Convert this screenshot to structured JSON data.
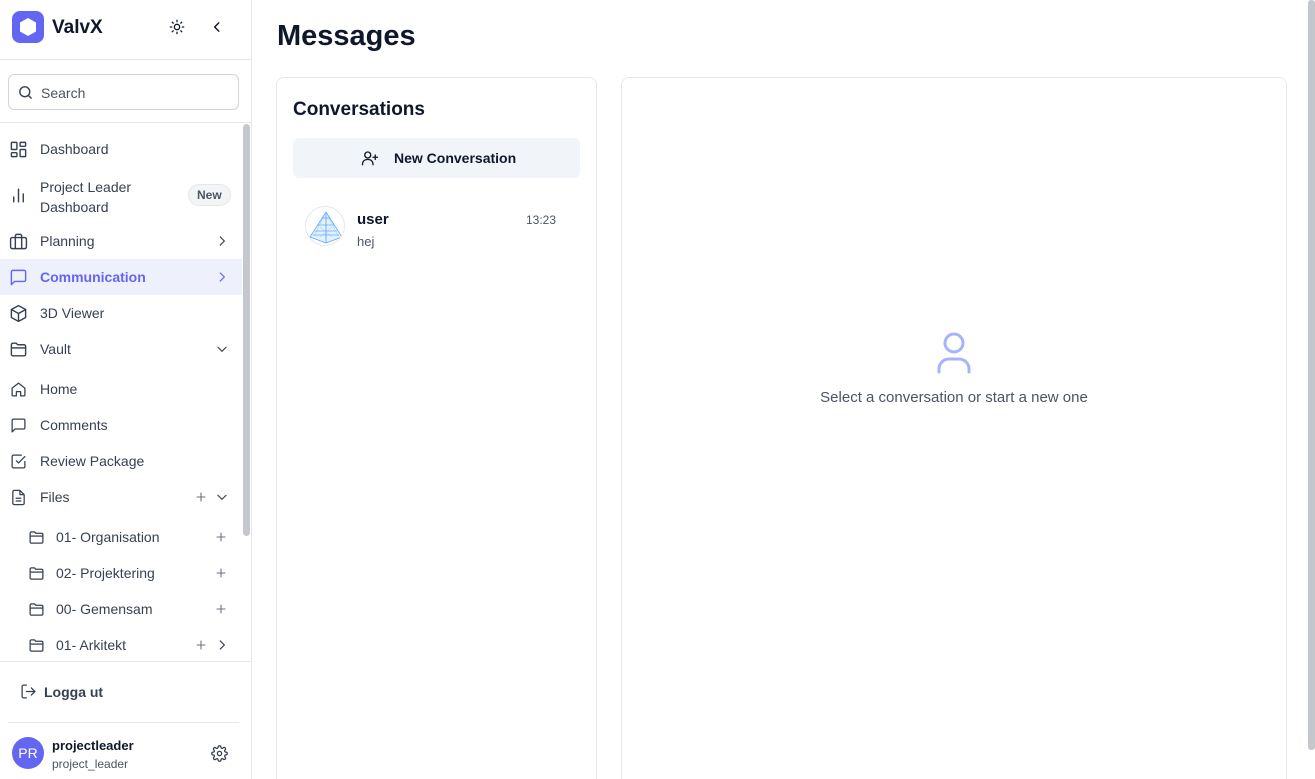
{
  "app": {
    "name": "ValvX"
  },
  "search": {
    "placeholder": "Search"
  },
  "nav": {
    "dashboard": "Dashboard",
    "pl_dashboard_line1": "Project Leader",
    "pl_dashboard_line2": "Dashboard",
    "pl_badge": "New",
    "planning": "Planning",
    "communication": "Communication",
    "viewer3d": "3D Viewer",
    "vault": "Vault",
    "home": "Home",
    "comments": "Comments",
    "review": "Review Package",
    "files": "Files",
    "folders": [
      "01- Organisation",
      "02- Projektering",
      "00- Gemensam",
      "01- Arkitekt"
    ]
  },
  "footer": {
    "logout": "Logga ut",
    "avatar_initials": "PR",
    "username": "projectleader",
    "role": "project_leader"
  },
  "main": {
    "title": "Messages",
    "conversations_title": "Conversations",
    "new_conversation": "New Conversation",
    "conversations": [
      {
        "name": "user",
        "time": "13:23",
        "last_message": "hej"
      }
    ],
    "empty_state": "Select a conversation or start a new one"
  },
  "colors": {
    "accent": "#6366f1",
    "active_bg": "#eef0fb"
  }
}
